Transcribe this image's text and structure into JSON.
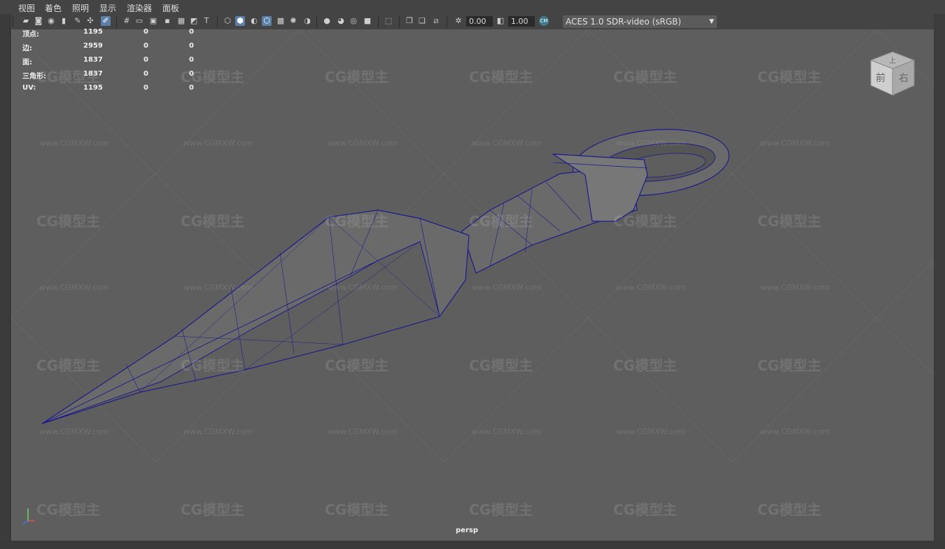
{
  "menu": [
    "视图",
    "着色",
    "照明",
    "显示",
    "渲染器",
    "面板"
  ],
  "toolbar": {
    "value1": "0.00",
    "value2": "1.00",
    "color_management": "ACES 1.0 SDR-video (sRGB)"
  },
  "hud": {
    "rows": [
      {
        "label": "顶点:",
        "v1": "1195",
        "v2": "0",
        "v3": "0"
      },
      {
        "label": "边:",
        "v1": "2959",
        "v2": "0",
        "v3": "0"
      },
      {
        "label": "面:",
        "v1": "1837",
        "v2": "0",
        "v3": "0"
      },
      {
        "label": "三角形:",
        "v1": "1837",
        "v2": "0",
        "v3": "0"
      },
      {
        "label": "UV:",
        "v1": "1195",
        "v2": "0",
        "v3": "0"
      }
    ]
  },
  "camera_label": "persp",
  "viewcube": {
    "top": "上",
    "front": "前",
    "right": "右"
  },
  "watermark": {
    "logo": "CG模型主",
    "url": "www.CGMXW.com"
  },
  "colors": {
    "wire": "#1c1c8a",
    "mesh": "#6a6a6a",
    "viewport": "#5e5e5e",
    "accent": "#5a7fa8"
  }
}
